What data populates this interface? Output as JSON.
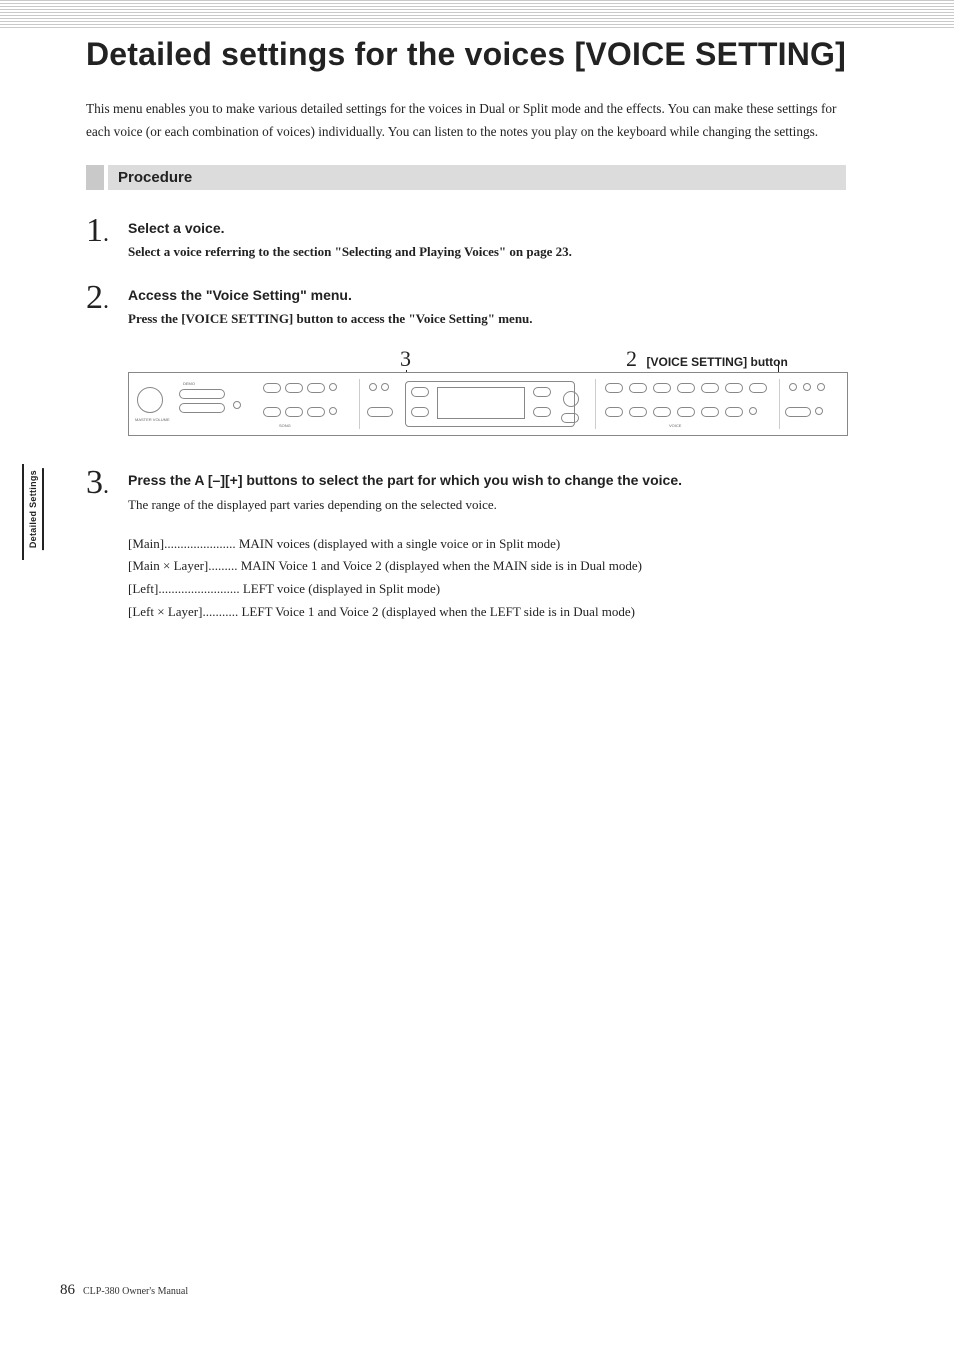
{
  "title": "Detailed settings for the voices [VOICE SETTING]",
  "intro": "This menu enables you to make various detailed settings for the voices in Dual or Split mode and the effects. You can make these settings for each voice (or each combination of voices) individually. You can listen to the notes you play on the keyboard while changing the settings.",
  "section_label": "Procedure",
  "steps": {
    "s1": {
      "num": "1",
      "headline": "Select a voice.",
      "sub": "Select a voice referring to the section \"Selecting and Playing Voices\" on page 23."
    },
    "s2": {
      "num": "2",
      "headline": "Access the \"Voice Setting\" menu.",
      "sub": "Press the [VOICE SETTING] button to access the \"Voice Setting\" menu."
    },
    "s3": {
      "num": "3",
      "headline": "Press the A [–][+] buttons to select the part for which you wish to change the voice.",
      "para": "The range of the displayed part varies depending on the selected voice."
    }
  },
  "callouts": {
    "c3": "3",
    "c2": "2",
    "c2_label": "[VOICE SETTING] button"
  },
  "defs": [
    {
      "key": "[Main]",
      "dots": "......................",
      "val": "MAIN voices (displayed with a single voice or in Split mode)"
    },
    {
      "key": "[Main × Layer]",
      "dots": ".........",
      "val": "MAIN Voice 1 and Voice 2 (displayed when the MAIN side is in Dual mode)"
    },
    {
      "key": "[Left]",
      "dots": ".........................",
      "val": "LEFT voice (displayed in Split mode)"
    },
    {
      "key": "[Left × Layer]",
      "dots": "...........",
      "val": "LEFT Voice 1 and Voice 2 (displayed when the LEFT side is in Dual mode)"
    }
  ],
  "sidetab": "Detailed Settings",
  "footer": {
    "page": "86",
    "text": "CLP-380 Owner's Manual"
  }
}
